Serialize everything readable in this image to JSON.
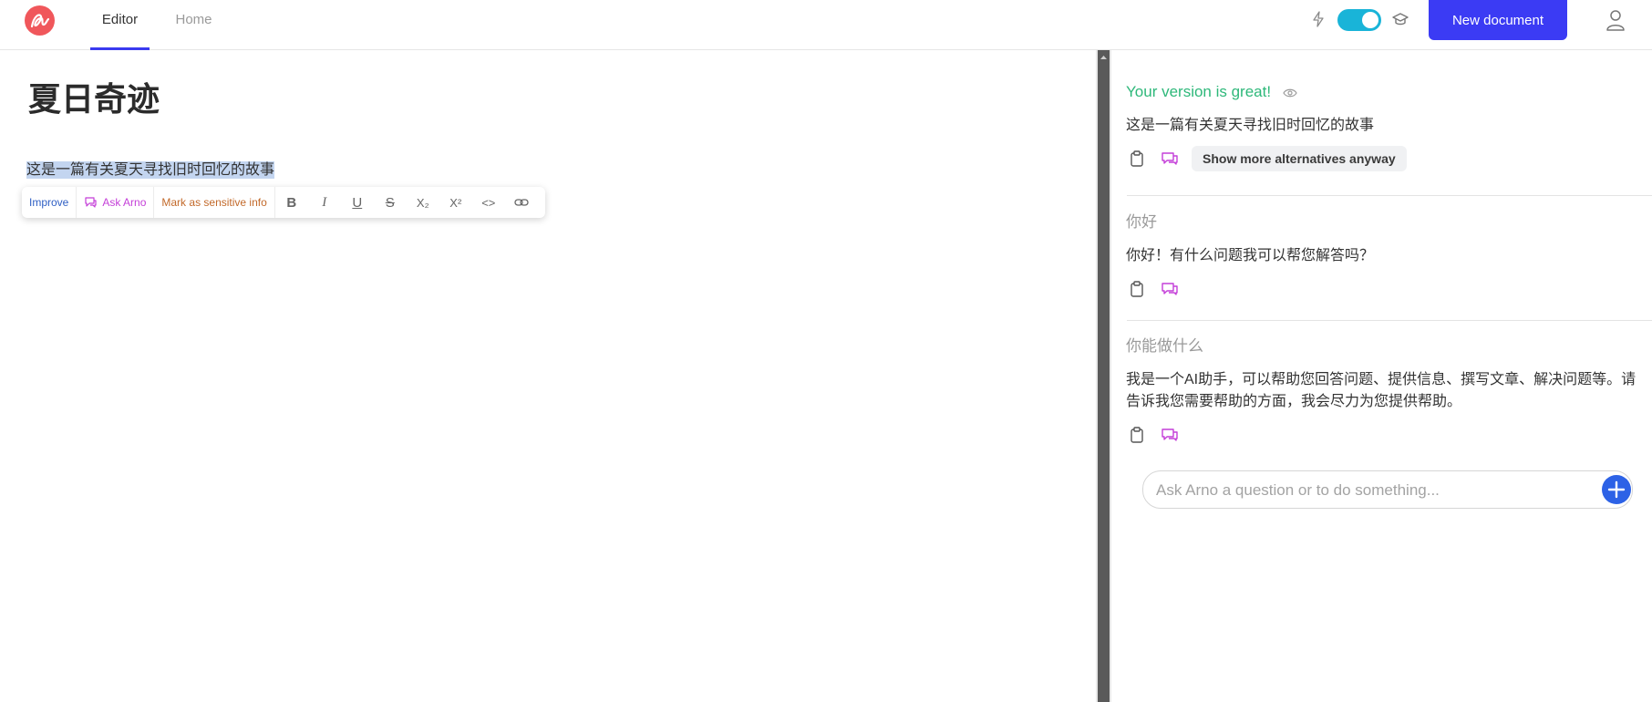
{
  "header": {
    "tabs": [
      {
        "label": "Editor",
        "active": true
      },
      {
        "label": "Home",
        "active": false
      }
    ],
    "toggle_on": true,
    "new_document_label": "New document",
    "icons": [
      "logo-icon",
      "bolt-icon",
      "graduation-cap-icon",
      "user-icon"
    ]
  },
  "editor": {
    "title": "夏日奇迹",
    "body_text": "这是一篇有关夏天寻找旧时回忆的故事",
    "toolbar": {
      "improve_label": "Improve",
      "ask_label": "Ask Arno",
      "sensitive_label": "Mark as sensitive info",
      "format_buttons": [
        "B",
        "I",
        "U",
        "S",
        "X₂",
        "X²",
        "<>",
        "link"
      ]
    }
  },
  "panel": {
    "entries": [
      {
        "title": "Your version is great!",
        "text": "这是一篇有关夏天寻找旧时回忆的故事",
        "show_more_label": "Show more alternatives anyway"
      },
      {
        "title": "你好",
        "text": "你好！有什么问题我可以帮您解答吗？"
      },
      {
        "title": "你能做什么",
        "text": "我是一个AI助手，可以帮助您回答问题、提供信息、撰写文章、解决问题等。请告诉我您需要帮助的方面，我会尽力为您提供帮助。"
      }
    ],
    "ask_placeholder": "Ask Arno a question or to do something..."
  },
  "colors": {
    "accent": "#3b3bf4",
    "toggle": "#19b4d8",
    "logo": "#f0575b",
    "success": "#2eb87a",
    "ask_arno": "#c43fd8",
    "sensitive": "#c2692a",
    "selection": "#c3d5f0"
  }
}
